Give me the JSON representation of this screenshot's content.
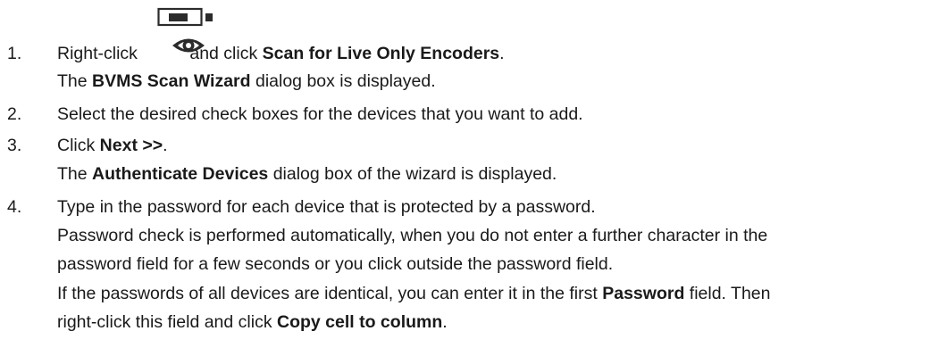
{
  "icons": {
    "encoder": "encoder-device-icon",
    "live": "live-view-eye-icon",
    "color": "#2b2b2b"
  },
  "steps": [
    {
      "number": "1.",
      "lines": [
        {
          "pre": "Right-click",
          "mid": " and click ",
          "bold": "Scan for Live Only Encoders",
          "post": "."
        },
        {
          "pre": "The ",
          "bold": "BVMS Scan Wizard",
          "post": " dialog box is displayed."
        }
      ]
    },
    {
      "number": "2.",
      "lines": [
        {
          "text": "Select the desired check boxes for the devices that you want to add."
        }
      ]
    },
    {
      "number": "3.",
      "lines": [
        {
          "pre": "Click ",
          "bold": "Next >>",
          "post": "."
        },
        {
          "pre": "The ",
          "bold": "Authenticate Devices",
          "post": " dialog box of the wizard is displayed."
        }
      ]
    },
    {
      "number": "4.",
      "lines": [
        {
          "text": "Type in the password for each device that is protected by a password."
        },
        {
          "text": "Password check is performed automatically, when you do not enter a further character in the"
        },
        {
          "text": "password field for a few seconds or you click outside the password field."
        },
        {
          "pre": "If the passwords of all devices are identical, you can enter it in the first ",
          "bold": "Password",
          "post": " field. Then"
        },
        {
          "pre": "right-click this field and click ",
          "bold": "Copy cell to column",
          "post": "."
        }
      ]
    }
  ]
}
